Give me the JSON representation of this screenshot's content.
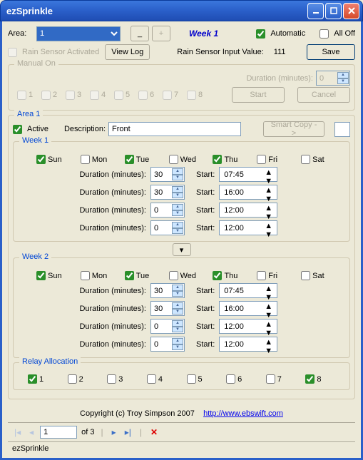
{
  "window": {
    "title": "ezSprinkle"
  },
  "top": {
    "area_label": "Area:",
    "area_value": "1",
    "minus": "_",
    "plus": "+",
    "week": "Week 1",
    "automatic_label": "Automatic",
    "automatic_checked": true,
    "alloff_label": "All Off",
    "alloff_checked": false,
    "rainsensor_label": "Rain Sensor Activated",
    "rainsensor_checked": false,
    "viewlog": "View Log",
    "rain_value_label": "Rain Sensor Input Value:",
    "rain_value": "111",
    "save": "Save"
  },
  "manual": {
    "legend": "Manual On",
    "nums": [
      "1",
      "2",
      "3",
      "4",
      "5",
      "6",
      "7",
      "8"
    ],
    "duration_label": "Duration (minutes):",
    "duration_value": "0",
    "start": "Start",
    "cancel": "Cancel"
  },
  "area1": {
    "legend": "Area 1",
    "active_label": "Active",
    "active_checked": true,
    "desc_label": "Description:",
    "desc_value": "Front",
    "smartcopy": "Smart Copy ->",
    "week1": {
      "legend": "Week 1",
      "days": [
        {
          "label": "Sun",
          "checked": true
        },
        {
          "label": "Mon",
          "checked": false
        },
        {
          "label": "Tue",
          "checked": true
        },
        {
          "label": "Wed",
          "checked": false
        },
        {
          "label": "Thu",
          "checked": true
        },
        {
          "label": "Fri",
          "checked": false
        },
        {
          "label": "Sat",
          "checked": false
        }
      ],
      "rows": [
        {
          "dur": "30",
          "start": "07:45"
        },
        {
          "dur": "30",
          "start": "16:00"
        },
        {
          "dur": "0",
          "start": "12:00"
        },
        {
          "dur": "0",
          "start": "12:00"
        }
      ]
    },
    "week2": {
      "legend": "Week 2",
      "days": [
        {
          "label": "Sun",
          "checked": true
        },
        {
          "label": "Mon",
          "checked": false
        },
        {
          "label": "Tue",
          "checked": true
        },
        {
          "label": "Wed",
          "checked": false
        },
        {
          "label": "Thu",
          "checked": true
        },
        {
          "label": "Fri",
          "checked": false
        },
        {
          "label": "Sat",
          "checked": false
        }
      ],
      "rows": [
        {
          "dur": "30",
          "start": "07:45"
        },
        {
          "dur": "30",
          "start": "16:00"
        },
        {
          "dur": "0",
          "start": "12:00"
        },
        {
          "dur": "0",
          "start": "12:00"
        }
      ]
    },
    "sched_dur_label": "Duration (minutes):",
    "sched_start_label": "Start:"
  },
  "relay": {
    "legend": "Relay Allocation",
    "items": [
      {
        "label": "1",
        "checked": true
      },
      {
        "label": "2",
        "checked": false
      },
      {
        "label": "3",
        "checked": false
      },
      {
        "label": "4",
        "checked": false
      },
      {
        "label": "5",
        "checked": false
      },
      {
        "label": "6",
        "checked": false
      },
      {
        "label": "7",
        "checked": false
      },
      {
        "label": "8",
        "checked": true
      }
    ]
  },
  "footer": {
    "copy": "Copyright (c) Troy Simpson 2007",
    "link_text": "http://www.ebswift.com",
    "link_href": "http://www.ebswift.com"
  },
  "nav": {
    "pos": "1",
    "of": "of 3"
  },
  "status": {
    "text": "ezSprinkle"
  }
}
